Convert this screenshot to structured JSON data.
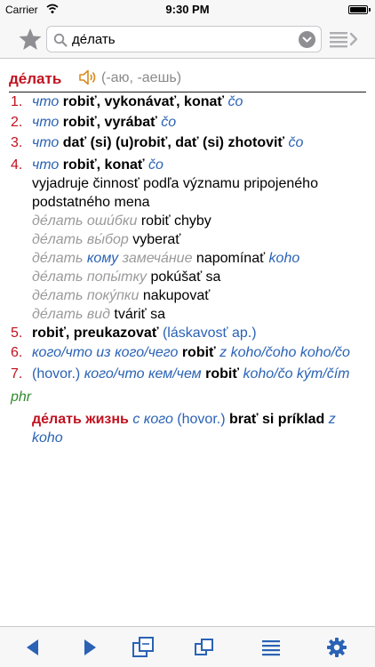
{
  "status_bar": {
    "carrier": "Carrier",
    "time": "9:30 PM"
  },
  "search": {
    "value": "де́лать"
  },
  "entry": {
    "headword": "де́лать",
    "grammar": "(-аю, -аешь)",
    "senses": [
      {
        "num": "1.",
        "ru": "что",
        "sk": "robiť, vykonávať, konať",
        "obj": "čo"
      },
      {
        "num": "2.",
        "ru": "что",
        "sk": "robiť, vyrábať",
        "obj": "čo"
      },
      {
        "num": "3.",
        "ru": "что",
        "sk": "dať (si) (u)robiť, dať (si) zhotoviť",
        "obj": "čo"
      },
      {
        "num": "4.",
        "ru": "что",
        "sk": "robiť, konať",
        "obj": "čo"
      }
    ],
    "sense4_note_1": "vyjadruje činnosť podľa významu pripojeného",
    "sense4_note_2": "podstatného mena",
    "examples": [
      {
        "ru": "де́лать оши́бки",
        "sk": "robiť chyby"
      },
      {
        "ru": "де́лать вы́бор",
        "sk": "vyberať"
      },
      {
        "ru_a": "де́лать",
        "ru_b": "кому",
        "ru_c": "замеча́ние",
        "sk": "napomínať",
        "obj": "koho"
      },
      {
        "ru": "де́лать попы́тку",
        "sk": "pokúšať sa"
      },
      {
        "ru": "де́лать поку́пки",
        "sk": "nakupovať"
      },
      {
        "ru": "де́лать вид",
        "sk": "tváriť sa"
      }
    ],
    "sense5": {
      "num": "5.",
      "sk": "robiť, preukazovať",
      "note": "(láskavosť ap.)"
    },
    "sense6": {
      "num": "6.",
      "ru": "кого/что из кого/чего",
      "sk": "robiť",
      "obj": "z koho/čoho koho/čo"
    },
    "sense7": {
      "num": "7.",
      "label": "(hovor.)",
      "ru": "кого/что кем/чем",
      "sk": "robiť",
      "obj": "koho/čo kým/čím"
    },
    "phr_label": "phr",
    "phrase": {
      "ru": "де́лать жизнь",
      "ru_obj": "с кого",
      "label": "(hovor.)",
      "sk": "brať si príklad",
      "obj_1": "z",
      "obj_2": "koho"
    }
  },
  "colors": {
    "accent": "#2a62b4",
    "headword": "#c1121f",
    "label_gray": "#9a9a9a",
    "phr": "#2f8a2f"
  },
  "icons": {
    "star": "star-icon",
    "search": "search-icon",
    "clear": "clear-icon",
    "list": "list-forward-icon",
    "speaker": "speaker-icon",
    "back": "back-arrow-icon",
    "forward": "forward-arrow-icon",
    "window": "new-window-icon",
    "stack": "stacked-windows-icon",
    "menu": "menu-lines-icon",
    "settings": "gear-icon"
  }
}
